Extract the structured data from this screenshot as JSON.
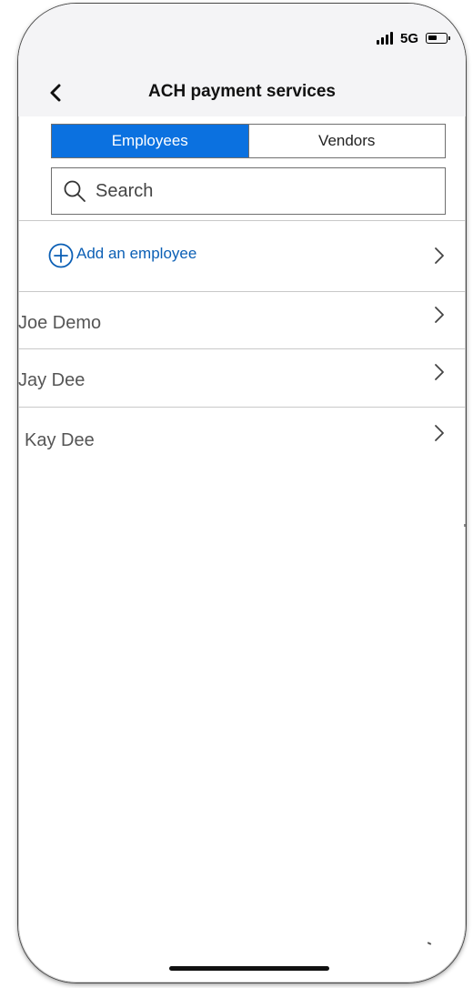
{
  "status_bar": {
    "network": "5G",
    "battery_level": 0.55
  },
  "header": {
    "title": "ACH payment services",
    "back_icon": "chevron-left-icon"
  },
  "tabs": [
    {
      "label": "Employees",
      "active": true
    },
    {
      "label": "Vendors",
      "active": false
    }
  ],
  "search": {
    "placeholder": "Search",
    "value": "",
    "icon": "search-icon"
  },
  "add_action": {
    "label": "Add an employee",
    "icon": "plus-circle-icon"
  },
  "employees": [
    {
      "name": "Joe Demo"
    },
    {
      "name": "Jay Dee"
    },
    {
      "name": "Kay Dee"
    }
  ],
  "colors": {
    "accent": "#0b71e0",
    "link": "#0b5fb5",
    "header_bg": "#f4f4f6",
    "divider": "#c9c9c9"
  }
}
